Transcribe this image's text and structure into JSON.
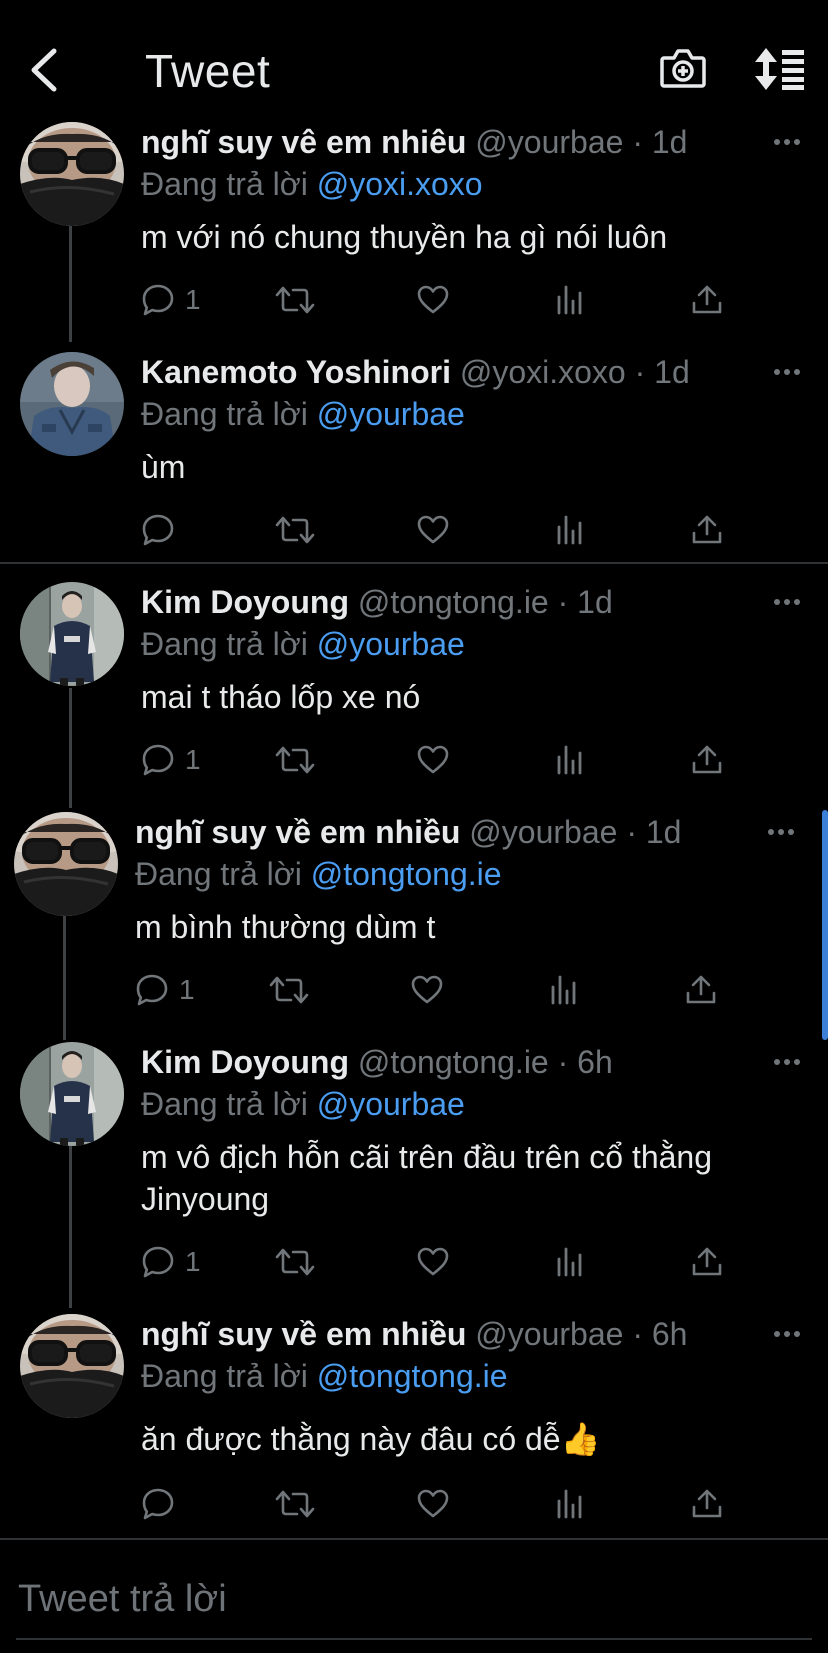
{
  "header": {
    "title": "Tweet"
  },
  "replying_prefix": "Đang trả lời ",
  "tweets": [
    {
      "name": "nghĩ suy vê em nhiêu",
      "meta": " @yourbae · 1d",
      "replying_to": "@yoxi.xoxo",
      "text": "m với nó chung thuyền ha gì nói luôn",
      "reply_count": "1"
    },
    {
      "name": "Kanemoto Yoshinori",
      "meta": " @yoxi.xoxo · 1d",
      "replying_to": "@yourbae",
      "text": "ùm",
      "reply_count": ""
    },
    {
      "name": "Kim Doyoung",
      "meta": " @tongtong.ie · 1d",
      "replying_to": "@yourbae",
      "text": "mai t tháo lốp xe nó",
      "reply_count": "1"
    },
    {
      "name": "nghĩ suy về em nhiều",
      "meta": " @yourbae · 1d",
      "replying_to": "@tongtong.ie",
      "text": "m bình thường dùm t",
      "reply_count": "1"
    },
    {
      "name": "Kim Doyoung",
      "meta": " @tongtong.ie · 6h",
      "replying_to": "@yourbae",
      "text": "m vô địch hỗn cãi trên đầu trên cổ thằng Jinyoung",
      "reply_count": "1"
    },
    {
      "name": "nghĩ suy về em nhiều",
      "meta": " @yourbae · 6h",
      "replying_to": "@tongtong.ie",
      "text": "ăn được thằng này đâu có dễ👍",
      "reply_count": ""
    }
  ],
  "composer": {
    "placeholder": "Tweet trả lời"
  },
  "colors": {
    "background": "#000000",
    "text": "#e7e9ea",
    "muted": "#71767b",
    "link": "#4a9df0",
    "divider": "#2f3336"
  }
}
